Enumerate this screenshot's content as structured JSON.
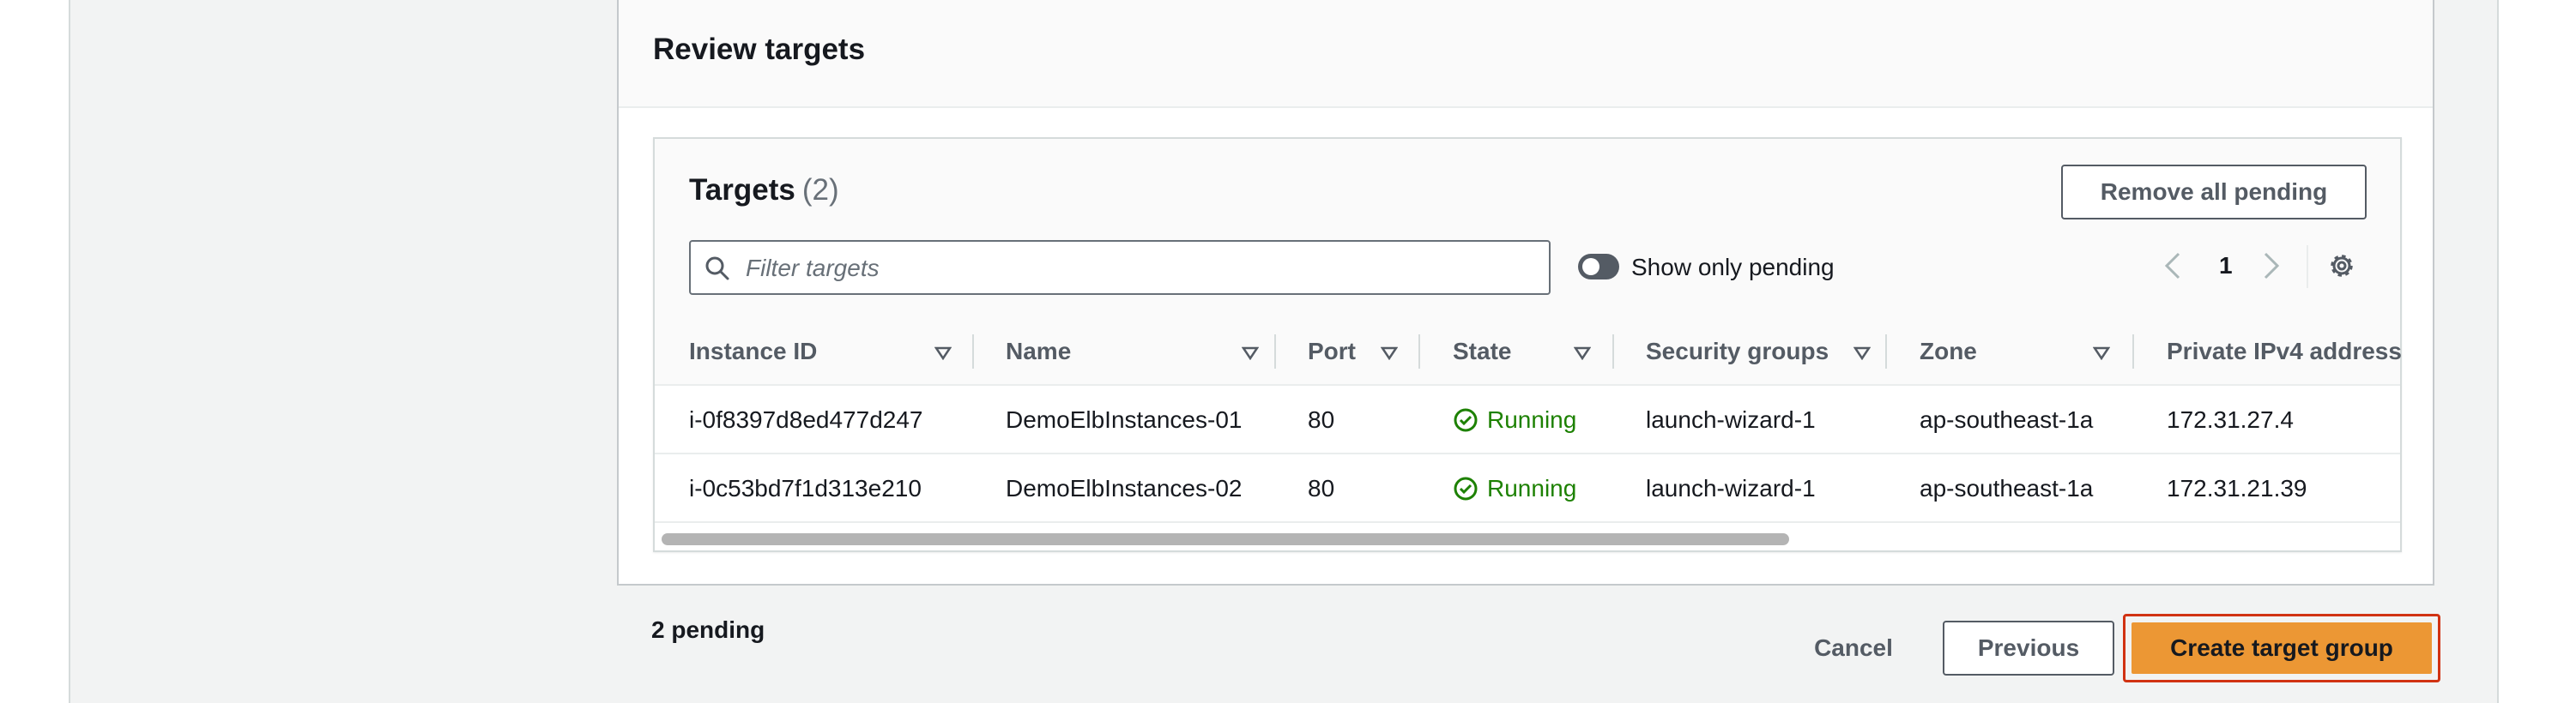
{
  "review": {
    "title": "Review targets"
  },
  "targets": {
    "title": "Targets",
    "count": "(2)",
    "remove_all_label": "Remove all pending",
    "filter_placeholder": "Filter targets",
    "show_only_pending_label": "Show only pending",
    "show_only_pending_on": false,
    "page": "1"
  },
  "table": {
    "columns": [
      "Instance ID",
      "Name",
      "Port",
      "State",
      "Security groups",
      "Zone",
      "Private IPv4 address"
    ],
    "rows": [
      {
        "instance_id": "i-0f8397d8ed477d247",
        "name": "DemoElbInstances-01",
        "port": "80",
        "state": "Running",
        "security_groups": "launch-wizard-1",
        "zone": "ap-southeast-1a",
        "private_ipv4": "172.31.27.4"
      },
      {
        "instance_id": "i-0c53bd7f1d313e210",
        "name": "DemoElbInstances-02",
        "port": "80",
        "state": "Running",
        "security_groups": "launch-wizard-1",
        "zone": "ap-southeast-1a",
        "private_ipv4": "172.31.21.39"
      }
    ]
  },
  "footer": {
    "pending_text": "2 pending",
    "cancel_label": "Cancel",
    "previous_label": "Previous",
    "create_label": "Create target group"
  },
  "colors": {
    "primary_button": "#ec9734",
    "focus_outline": "#d13212",
    "running_status": "#1d8102"
  },
  "icons": {
    "filter": "search-icon",
    "pager_prev": "chevron-left-icon",
    "pager_next": "chevron-right-icon",
    "settings": "gear-icon",
    "sort": "sort-caret-down-icon",
    "state": "check-circle-icon"
  }
}
